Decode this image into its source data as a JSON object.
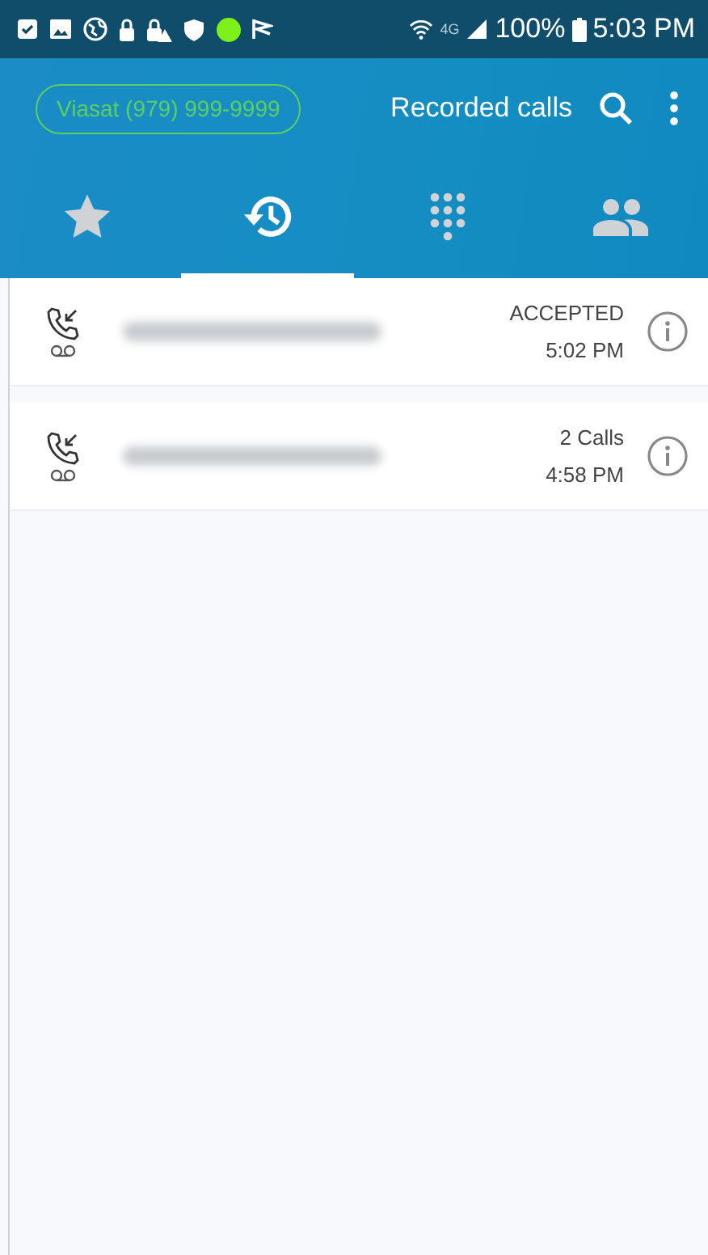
{
  "status_bar": {
    "network": "4G",
    "battery": "100%",
    "time": "5:03 PM"
  },
  "header": {
    "account": "Viasat (979) 999-9999",
    "title": "Recorded calls"
  },
  "tabs": [
    {
      "kind": "favorites",
      "selected": false
    },
    {
      "kind": "recents",
      "selected": true
    },
    {
      "kind": "keypad",
      "selected": false
    },
    {
      "kind": "contacts",
      "selected": false
    }
  ],
  "calls": [
    {
      "status": "ACCEPTED",
      "time": "5:02 PM"
    },
    {
      "status": "2 Calls",
      "time": "4:58 PM"
    }
  ]
}
